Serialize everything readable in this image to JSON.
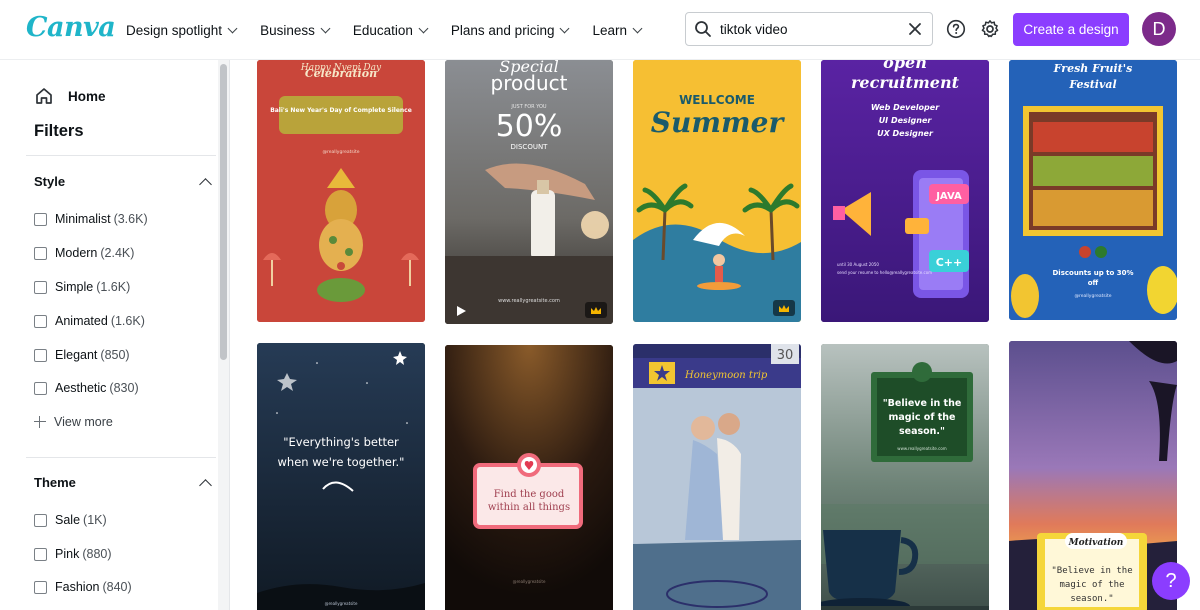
{
  "app": {
    "logo_text": "Canva",
    "brand_color": "#8b3dff",
    "logo_color": "#1fb5c9"
  },
  "nav": {
    "items": [
      {
        "label": "Design spotlight"
      },
      {
        "label": "Business"
      },
      {
        "label": "Education"
      },
      {
        "label": "Plans and pricing"
      },
      {
        "label": "Learn"
      }
    ]
  },
  "search": {
    "value": "tiktok video",
    "icon": "search-icon",
    "clear_icon": "close-icon"
  },
  "header": {
    "create_label": "Create a design",
    "avatar_initial": "D",
    "help_icon": "help-icon",
    "settings_icon": "gear-icon"
  },
  "sidebar": {
    "home_label": "Home",
    "filters_title": "Filters",
    "style": {
      "title": "Style",
      "options": [
        {
          "label": "Minimalist",
          "count": "(3.6K)"
        },
        {
          "label": "Modern",
          "count": "(2.4K)"
        },
        {
          "label": "Simple",
          "count": "(1.6K)"
        },
        {
          "label": "Animated",
          "count": "(1.6K)"
        },
        {
          "label": "Elegant",
          "count": "(850)"
        },
        {
          "label": "Aesthetic",
          "count": "(830)"
        }
      ],
      "view_more": "View more"
    },
    "theme": {
      "title": "Theme",
      "options": [
        {
          "label": "Sale",
          "count": "(1K)"
        },
        {
          "label": "Pink",
          "count": "(880)"
        },
        {
          "label": "Fashion",
          "count": "(840)"
        }
      ]
    }
  },
  "templates": {
    "row1": [
      {
        "line1": "Happy Nyepi Day",
        "line2": "Celebration",
        "line3": "Bali's New Year's Day of Complete Silence",
        "line4": "@reallygreatsite"
      },
      {
        "line1": "Special",
        "line2": "product",
        "line3": "JUST FOR YOU",
        "line4": "50%",
        "line5": "DISCOUNT",
        "line6": "www.reallygreatsite.com"
      },
      {
        "line1": "WELLCOME",
        "line2": "Summer"
      },
      {
        "line1": "open",
        "line2": "recruitment",
        "line3": "Web Developer",
        "line4": "UI Designer",
        "line5": "UX Designer",
        "line6": "JAVA",
        "line7": "C++",
        "line8": "until 30 August 2050",
        "line9": "send your resume to hello@reallygreatsite.com"
      },
      {
        "line1": "Fresh Fruit's",
        "line2": "Festival",
        "line3": "Discounts up to 30%",
        "line4": "off",
        "line5": "@reallygreatsite"
      }
    ],
    "row2": [
      {
        "line1": "\"Everything's better",
        "line2": "when we're together.\"",
        "line3": "@reallygreatsite"
      },
      {
        "line1": "Find the good",
        "line2": "within all things",
        "line3": "@reallygreatsite"
      },
      {
        "line1": "Honeymoon trip",
        "line2": "30"
      },
      {
        "line1": "\"Believe in the",
        "line2": "magic of the",
        "line3": "season.\"",
        "line4": "www.reallygreatsite.com"
      },
      {
        "line1": "Motivation",
        "line2": "\"Believe in the",
        "line3": "magic of the",
        "line4": "season.\""
      }
    ]
  },
  "help_fab": {
    "label": "?"
  }
}
